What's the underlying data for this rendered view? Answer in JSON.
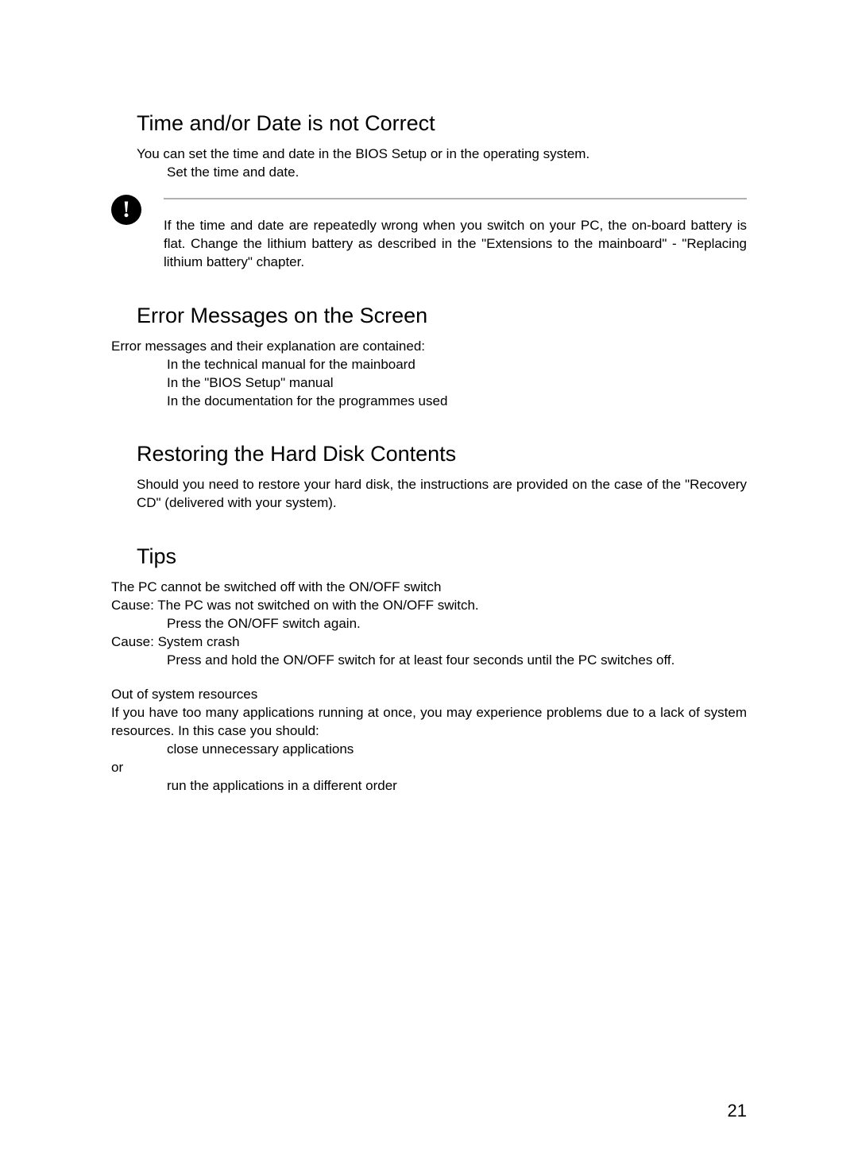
{
  "sections": {
    "timeDate": {
      "heading": "Time and/or Date is not Correct",
      "intro": "You can set the time and date in the BIOS Setup or in the operating system.",
      "action": "Set the time and date.",
      "note": "If the time and date are repeatedly wrong when you switch on your PC, the on-board battery is flat. Change the lithium battery as described in the \"Extensions to the mainboard\" - \"Replacing lithium battery\" chapter."
    },
    "errorMessages": {
      "heading": "Error Messages on the Screen",
      "intro": "Error messages and their explanation are contained:",
      "bullets": [
        "In the technical manual for the mainboard",
        "In the \"BIOS Setup\" manual",
        "In the documentation for the programmes used"
      ]
    },
    "restoring": {
      "heading": "Restoring the Hard Disk Contents",
      "body": "Should you need to restore your hard disk, the instructions are provided on the case of the \"Recovery CD\" (delivered with your system)."
    },
    "tips": {
      "heading": "Tips",
      "t1_title": "The PC cannot be switched off with the ON/OFF switch",
      "t1_cause1": "Cause: The PC was not switched on with the ON/OFF switch.",
      "t1_action1": "Press the ON/OFF switch again.",
      "t1_cause2": "Cause: System crash",
      "t1_action2": "Press and hold the ON/OFF switch for at least four seconds until the PC switches off.",
      "t2_title": "Out of system resources",
      "t2_body": "If you have too many applications running at once, you may experience problems due to a lack of system resources. In this case you should:",
      "t2_action1": "close unnecessary applications",
      "or": " or",
      "t2_action2": "run the applications in a different order"
    }
  },
  "pageNumber": "21",
  "icons": {
    "exclaim": "!"
  }
}
